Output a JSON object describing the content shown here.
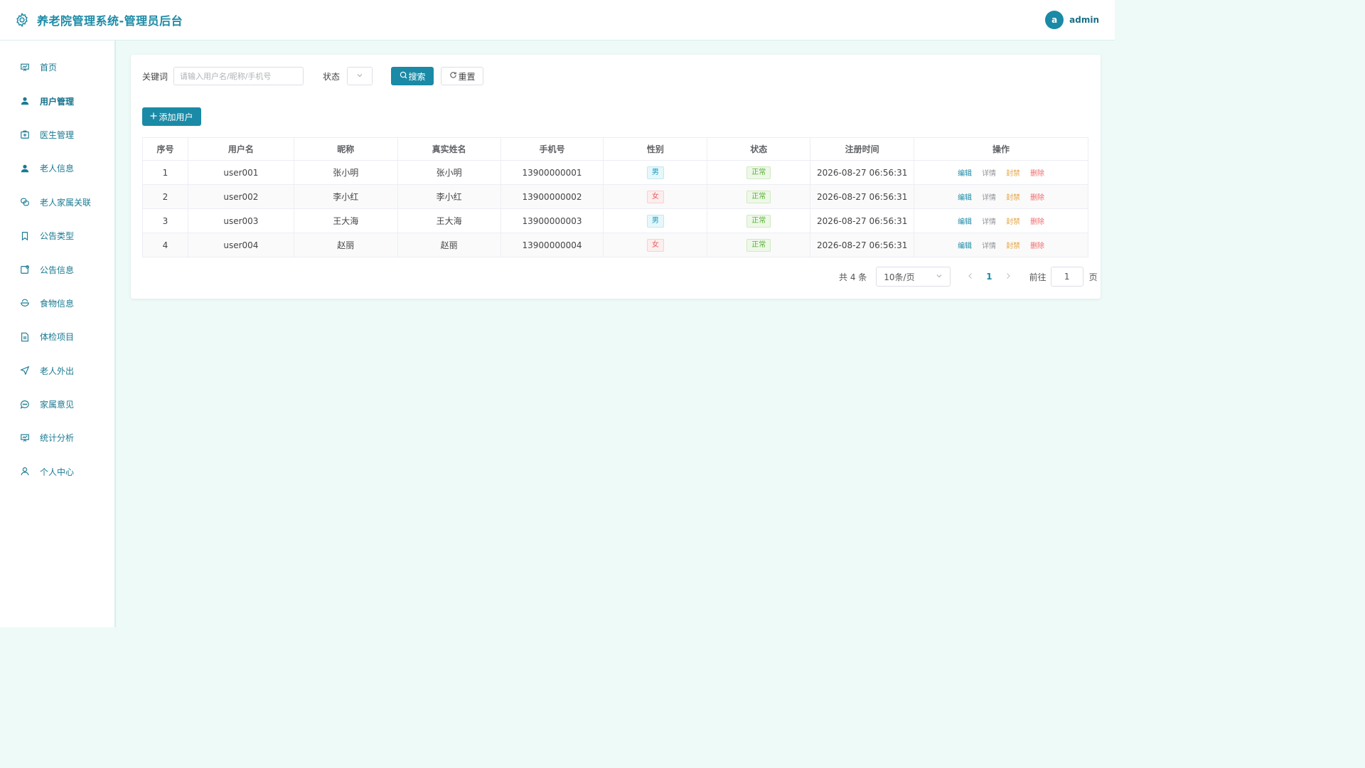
{
  "header": {
    "title": "养老院管理系统-管理员后台",
    "brand_icon": "gear-icon",
    "avatar_letter": "a",
    "username": "admin",
    "accent": "#1a8aa6"
  },
  "sidebar": {
    "items": [
      {
        "label": "首页",
        "icon": "chart-board-icon"
      },
      {
        "label": "用户管理",
        "icon": "user-icon",
        "active": true
      },
      {
        "label": "医生管理",
        "icon": "medical-kit-icon"
      },
      {
        "label": "老人信息",
        "icon": "user-icon"
      },
      {
        "label": "老人家属关联",
        "icon": "link-icon"
      },
      {
        "label": "公告类型",
        "icon": "bookmark-icon"
      },
      {
        "label": "公告信息",
        "icon": "notice-icon"
      },
      {
        "label": "食物信息",
        "icon": "food-icon"
      },
      {
        "label": "体检项目",
        "icon": "document-icon"
      },
      {
        "label": "老人外出",
        "icon": "send-icon"
      },
      {
        "label": "家属意见",
        "icon": "chat-icon"
      },
      {
        "label": "统计分析",
        "icon": "chart-board-icon"
      },
      {
        "label": "个人中心",
        "icon": "person-outline-icon"
      }
    ]
  },
  "filters": {
    "keyword_label": "关键词",
    "keyword_placeholder": "请输入用户名/昵称/手机号",
    "keyword_value": "",
    "status_label": "状态",
    "status_value": "",
    "search_label": "搜索",
    "reset_label": "重置"
  },
  "actions": {
    "add_label": "添加用户"
  },
  "table": {
    "columns": [
      "序号",
      "用户名",
      "昵称",
      "真实姓名",
      "手机号",
      "性别",
      "状态",
      "注册时间",
      "操作"
    ],
    "rows": [
      {
        "index": "1",
        "username": "user001",
        "nickname": "张小明",
        "real_name": "张小明",
        "phone": "13900000001",
        "gender": "男",
        "status": "正常",
        "registered": "2026-08-27 06:56:31"
      },
      {
        "index": "2",
        "username": "user002",
        "nickname": "李小红",
        "real_name": "李小红",
        "phone": "13900000002",
        "gender": "女",
        "status": "正常",
        "registered": "2026-08-27 06:56:31"
      },
      {
        "index": "3",
        "username": "user003",
        "nickname": "王大海",
        "real_name": "王大海",
        "phone": "13900000003",
        "gender": "男",
        "status": "正常",
        "registered": "2026-08-27 06:56:31"
      },
      {
        "index": "4",
        "username": "user004",
        "nickname": "赵丽",
        "real_name": "赵丽",
        "phone": "13900000004",
        "gender": "女",
        "status": "正常",
        "registered": "2026-08-27 06:56:31"
      }
    ],
    "ops": {
      "edit": "编辑",
      "detail": "详情",
      "ban": "封禁",
      "delete": "删除"
    }
  },
  "pagination": {
    "total_text": "共 4 条",
    "page_size": "10条/页",
    "current_page": "1",
    "goto_label": "前往",
    "goto_value": "1",
    "page_unit": "页"
  }
}
